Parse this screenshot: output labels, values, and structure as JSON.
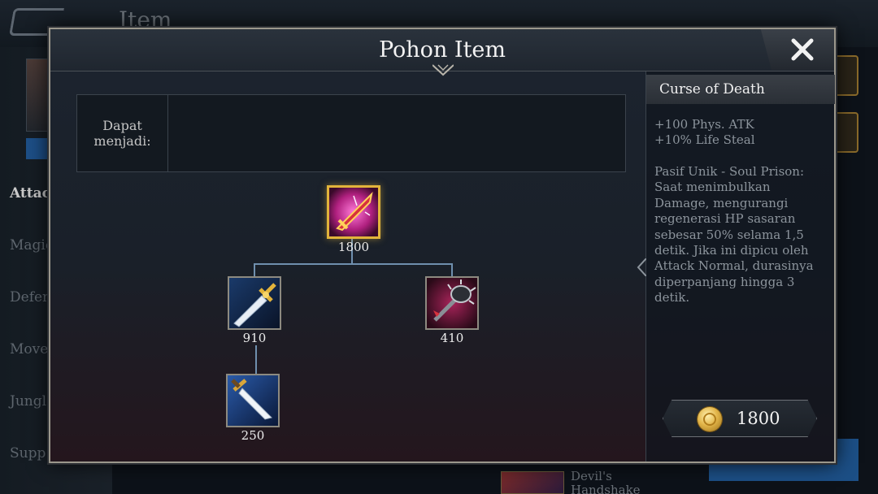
{
  "background": {
    "title": "Item",
    "categories": [
      "Attac",
      "Magic",
      "Defen",
      "Move",
      "Jungl",
      "Supp"
    ],
    "bottom_item_text": "Devil's\nHandshake"
  },
  "modal": {
    "title": "Pohon Item",
    "build_into_label": "Dapat\nmenjadi:"
  },
  "tree": {
    "root": {
      "icon": "curse-of-death-sword-icon",
      "price": "1800"
    },
    "child_left": {
      "icon": "golden-sword-icon",
      "price": "910"
    },
    "child_right": {
      "icon": "spiked-mace-icon",
      "price": "410"
    },
    "grandchild": {
      "icon": "dagger-icon",
      "price": "250"
    }
  },
  "detail": {
    "name": "Curse of Death",
    "stats": "+100 Phys. ATK\n+10% Life Steal",
    "passive": "Pasif Unik - Soul Prison: Saat menimbulkan Damage, mengurangi regenerasi HP sasaran sebesar 50% selama 1,5 detik. Jika ini dipicu oleh Attack Normal, durasinya diperpanjang hingga 3 detik.",
    "total_price": "1800",
    "currency_icon": "gold-coin-icon"
  },
  "colors": {
    "selected_border": "#e2b43b",
    "tree_line": "#6f8fae",
    "frame_border": "#9b978c"
  }
}
